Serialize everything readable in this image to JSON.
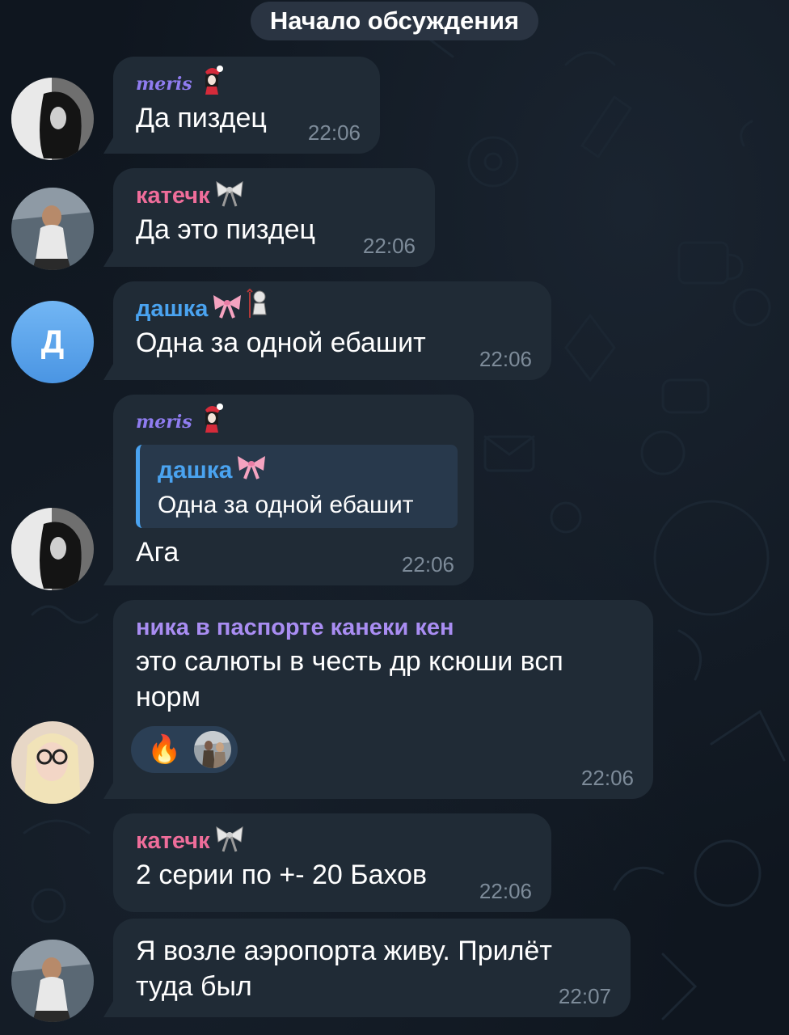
{
  "header": {
    "date_chip": "Начало обсуждения"
  },
  "colors": {
    "meris": "#8f7cf0",
    "katechk": "#ef6d9a",
    "dashka": "#4aa3f0",
    "nika": "#a98df2",
    "time": "#7d8b99",
    "bubble": "#202b36"
  },
  "messages": [
    {
      "sender": "meris",
      "text": "Да пиздец",
      "time": "22:06",
      "decor": "santa-girl-sticker-icon"
    },
    {
      "sender": "катечк",
      "text": "Да это пиздец",
      "time": "22:06",
      "decor": "bow-icon"
    },
    {
      "sender": "дашка",
      "avatar_letter": "Д",
      "text": "Одна за одной ебашит",
      "time": "22:06",
      "decor": "pink-bow-icon"
    },
    {
      "sender": "meris",
      "reply_name": "дашка",
      "reply_text": "Одна за одной ебашит",
      "text": "Ага",
      "time": "22:06"
    },
    {
      "sender": "ника в паспорте канеки кен",
      "text_lines": [
        "это салюты в честь др ксюши всп",
        "норм"
      ],
      "time": "22:06",
      "reactions": [
        {
          "emoji": "🔥",
          "icon": "fire-icon"
        }
      ]
    },
    {
      "sender": "катечк",
      "text": "2 серии по +- 20 Бахов",
      "time": "22:06"
    },
    {
      "text_lines": [
        "Я возле аэропорта живу. Прилёт",
        "туда был"
      ],
      "time": "22:07"
    }
  ]
}
